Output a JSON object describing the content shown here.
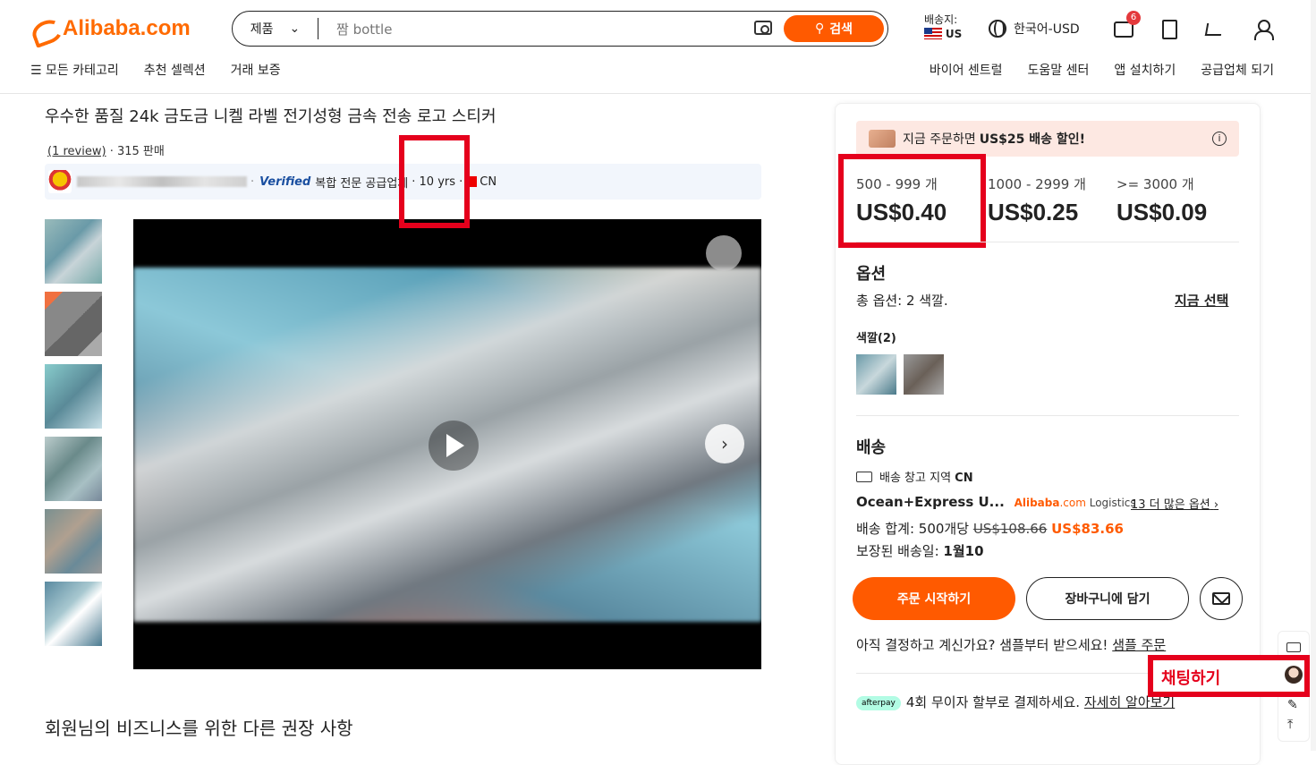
{
  "header": {
    "logo": "Alibaba.com",
    "search": {
      "category": "제품",
      "query": "짬 bottle",
      "button": "검색"
    },
    "ship_to": {
      "label": "배송지:",
      "country": "US"
    },
    "language": "한국어-USD",
    "message_count": "6",
    "nav_left": [
      "모든 카테고리",
      "추천 셀렉션",
      "거래 보증"
    ],
    "nav_right": [
      "바이어 센트럴",
      "도움말 센터",
      "앱 설치하기",
      "공급업체 되기"
    ]
  },
  "product": {
    "title": "우수한 품질 24k 금도금 니켈 라벨 전기성형 금속 전송 로고 스티커",
    "reviews": "(1 review)",
    "sold": "· 315 판매",
    "supplier_verified": "Verified",
    "supplier_type": "복합 전문 공급업체",
    "supplier_years": "· 10 yrs ·",
    "supplier_country": "CN"
  },
  "pricing": {
    "promo": "지금 주문하면",
    "promo_bold": "US$25 배송 할인!",
    "tiers": [
      {
        "range": "500 - 999 개",
        "price": "US$0.40"
      },
      {
        "range": "1000 - 2999 개",
        "price": "US$0.25"
      },
      {
        "range": ">= 3000 개",
        "price": "US$0.09"
      }
    ]
  },
  "options": {
    "heading": "옵션",
    "total": "총 옵션: 2 색깔.",
    "select_now": "지금 선택",
    "color_label": "색깔(2)"
  },
  "shipping": {
    "heading": "배송",
    "warehouse": "배송 창고 지역",
    "warehouse_country": "CN",
    "method": "Ocean+Express U...",
    "logistics_brand": "Alibaba",
    "logistics_suffix": ".com",
    "logistics_word": "Logistics",
    "more_options": "13 더 많은 옵션",
    "total_label": "배송 합계: 500개당",
    "old_price": "US$108.66",
    "new_price": "US$83.66",
    "guaranteed_label": "보장된 배송일:",
    "guaranteed_date": "1월10"
  },
  "actions": {
    "order": "주문 시작하기",
    "cart": "장바구니에 담기",
    "sample_note": "아직 결정하고 계신가요? 샘플부터 받으세요!",
    "sample_link": "샘플 주문",
    "afterpay_logo": "afterpay",
    "afterpay_text": "4회 무이자 할부로 결제하세요.",
    "afterpay_link": "자세히 알아보기",
    "chat": "채팅하기"
  },
  "recommend_title": "회원님의 비즈니스를 위한 다른 권장 사항",
  "colors": {
    "accent": "#ff5a00",
    "highlight": "#e5001c",
    "verified": "#1a4fa0"
  }
}
